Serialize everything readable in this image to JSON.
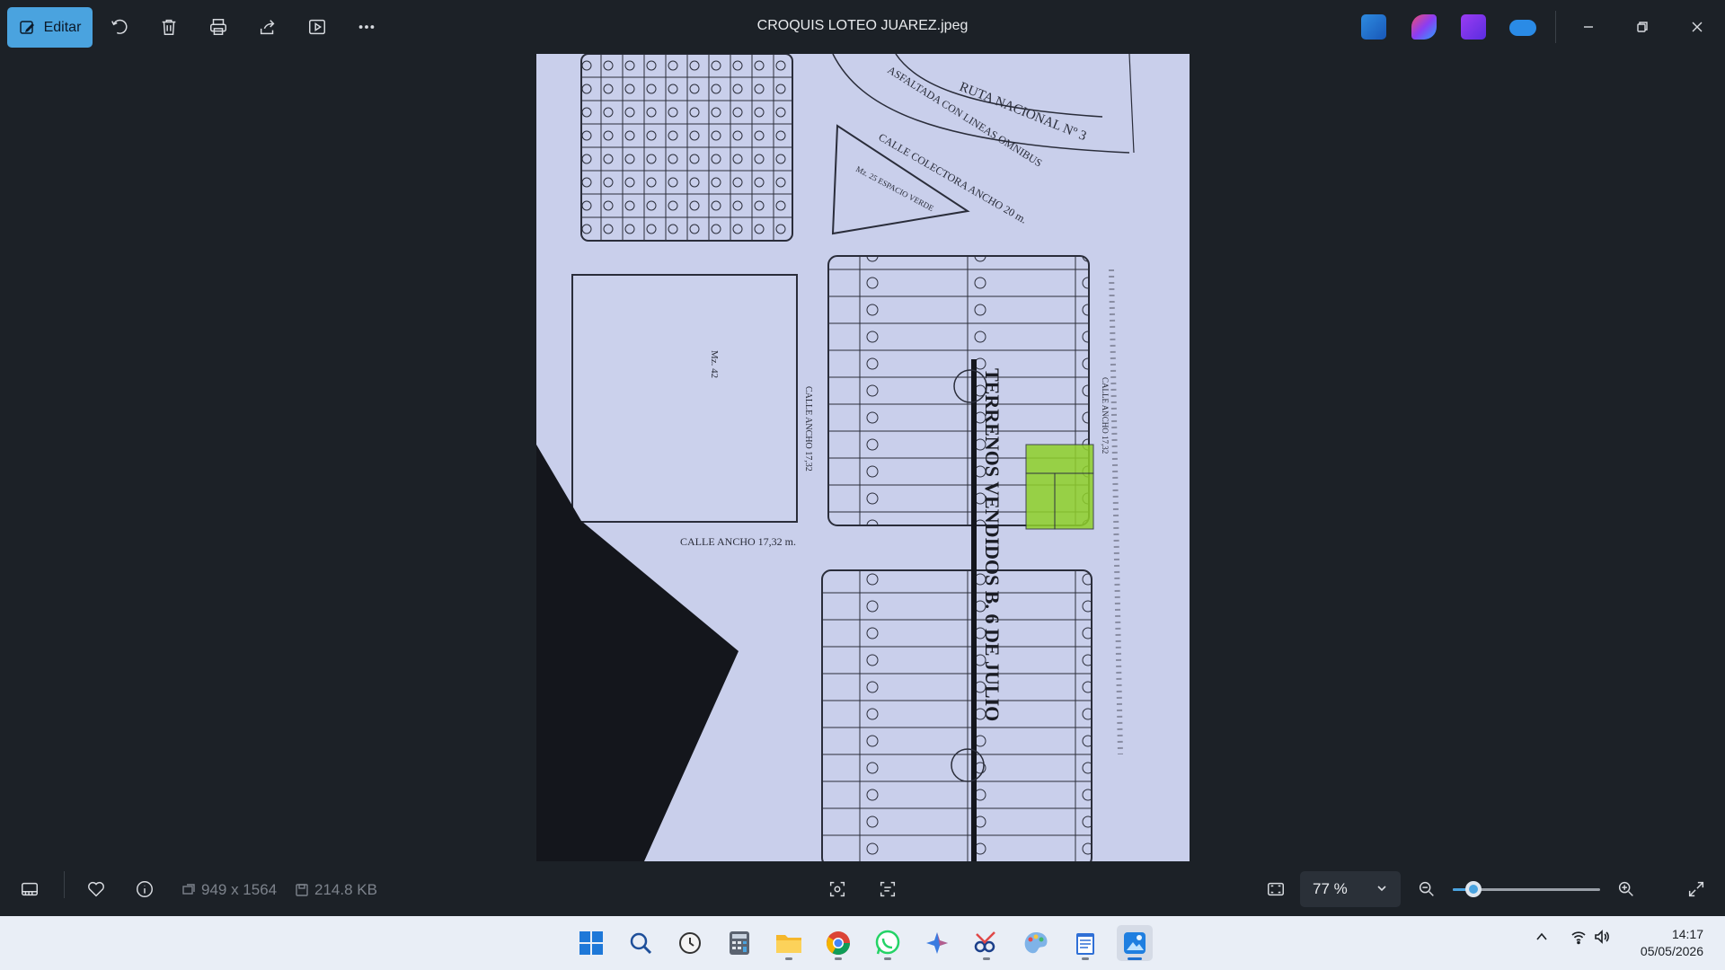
{
  "toolbar": {
    "edit_label": "Editar",
    "title": "CROQUIS LOTEO JUAREZ.jpeg",
    "icons": [
      "edit-icon",
      "rotate-icon",
      "delete-icon",
      "print-icon",
      "share-icon",
      "slideshow-icon",
      "more-icon"
    ],
    "app_icons": [
      "photos-editor-icon",
      "clipchamp-icon",
      "movie-maker-icon",
      "onedrive-icon"
    ],
    "window_controls": [
      "minimize-icon",
      "restore-icon",
      "close-icon"
    ]
  },
  "image_text": {
    "route": "RUTA NACIONAL Nº 3",
    "route_note": "ASFALTADA CON LINEAS OMNIBUS",
    "collector": "CALLE COLECTORA ANCHO 20 m.",
    "street_bottom": "CALLE ANCHO 17,32 m.",
    "street_mid": "CALLE ANCHO 17,32",
    "street_right": "CALLE ANCHO 17,32",
    "stamp": "TERRENOS VENDIDOS B. 6 DE JULIO",
    "block": "Mz. 42",
    "triangle_note": "Mz. 25 ESPACIO VERDE"
  },
  "bottom_bar": {
    "dimensions": "949 x 1564",
    "size": "214.8 KB",
    "zoom": "77 %",
    "zoom_fraction": 0.14
  },
  "taskbar": {
    "apps": [
      "windows-start-icon",
      "search-icon",
      "clock-app-icon",
      "calculator-icon",
      "file-explorer-icon",
      "chrome-icon",
      "whatsapp-icon",
      "copilot-icon",
      "snipping-tool-icon",
      "paint-icon",
      "notepad-icon",
      "photos-icon"
    ],
    "time": "14:17",
    "date": "05/05/2026"
  },
  "colors": {
    "accent": "#4aa3df",
    "background": "#1c2127",
    "taskbar": "#e9eef6",
    "highlight_lots": "#8fd12a"
  }
}
